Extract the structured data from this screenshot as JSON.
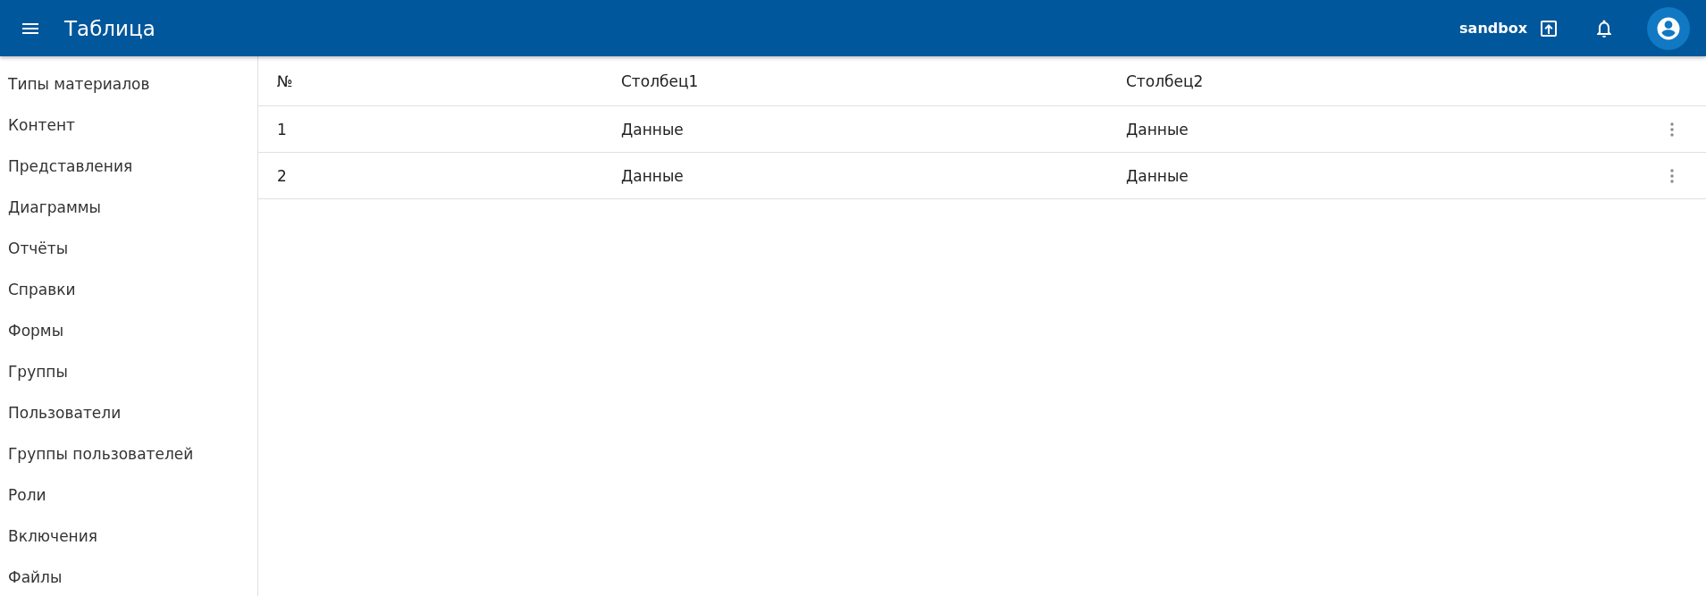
{
  "app_bar": {
    "title": "Таблица",
    "workspace": "sandbox"
  },
  "sidebar": {
    "items": [
      {
        "label": "Типы материалов"
      },
      {
        "label": "Контент"
      },
      {
        "label": "Представления"
      },
      {
        "label": "Диаграммы"
      },
      {
        "label": "Отчёты"
      },
      {
        "label": "Справки"
      },
      {
        "label": "Формы"
      },
      {
        "label": "Группы"
      },
      {
        "label": "Пользователи"
      },
      {
        "label": "Группы пользователей"
      },
      {
        "label": "Роли"
      },
      {
        "label": "Включения"
      },
      {
        "label": "Файлы"
      }
    ]
  },
  "table": {
    "columns": [
      "№",
      "Столбец1",
      "Столбец2"
    ],
    "rows": [
      {
        "cells": [
          "1",
          "Данные",
          "Данные"
        ]
      },
      {
        "cells": [
          "2",
          "Данные",
          "Данные"
        ]
      }
    ]
  }
}
